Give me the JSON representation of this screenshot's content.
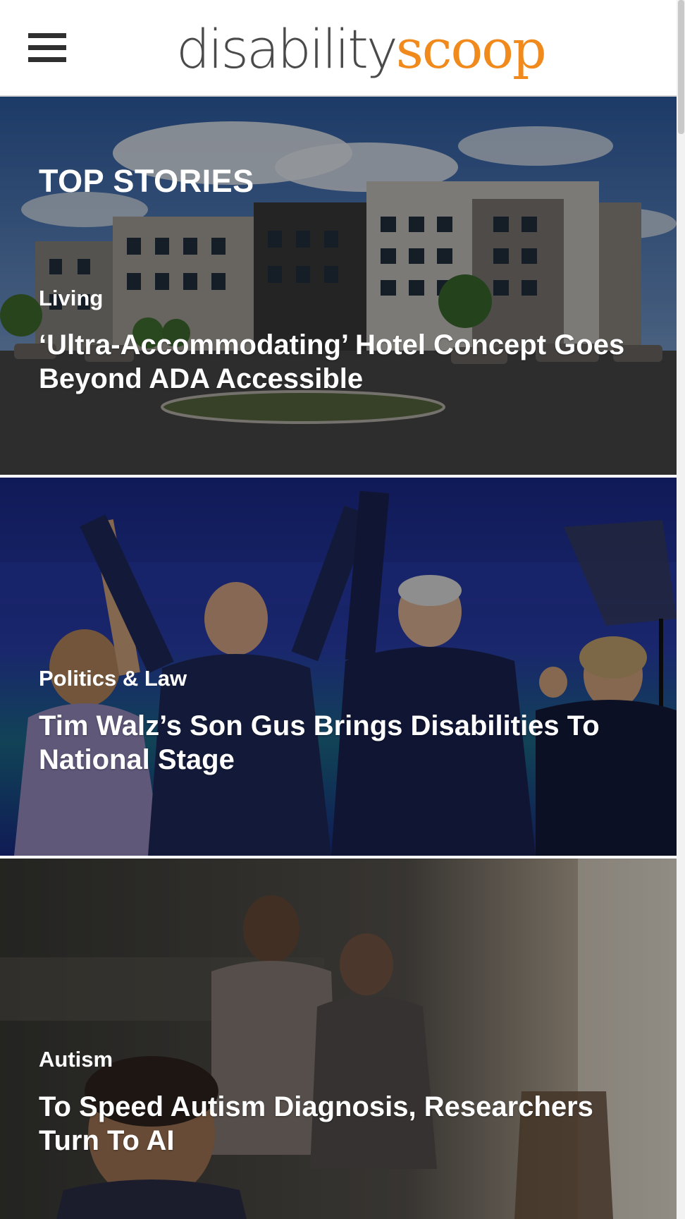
{
  "header": {
    "menu_icon": "hamburger-menu-icon",
    "logo_part1": "disability",
    "logo_part2": "scoop"
  },
  "section": {
    "title": "TOP STORIES"
  },
  "stories": [
    {
      "category": "Living",
      "headline": "‘Ultra-Accommodating’ Hotel Concept Goes Beyond ADA Accessible",
      "image": "hotel-building-photo"
    },
    {
      "category": "Politics & Law",
      "headline": "Tim Walz’s Son Gus Brings Disabilities To National Stage",
      "image": "convention-stage-photo"
    },
    {
      "category": "Autism",
      "headline": "To Speed Autism Diagnosis, Researchers Turn To AI",
      "image": "family-child-photo"
    }
  ],
  "colors": {
    "logo_gray": "#4a4a4a",
    "logo_orange": "#f08a1c",
    "text_white": "#ffffff"
  }
}
